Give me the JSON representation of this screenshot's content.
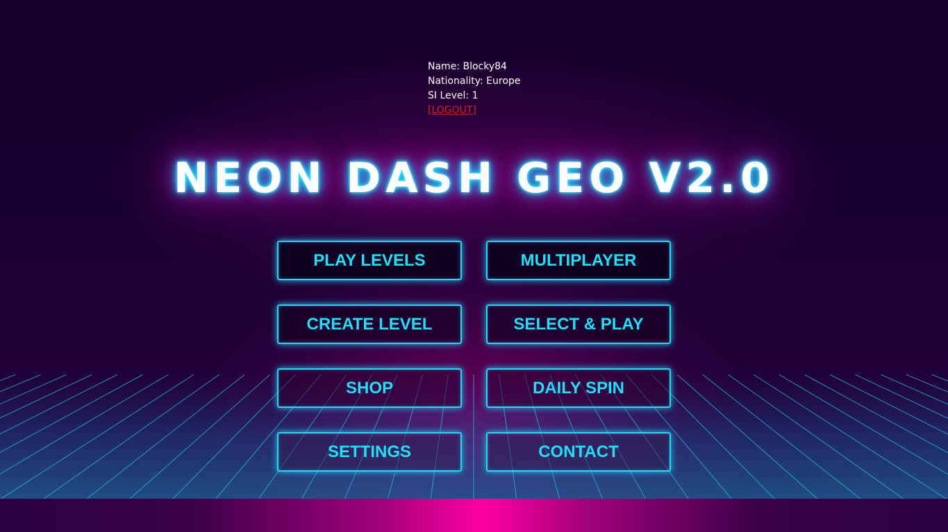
{
  "player": {
    "name_line": "Name: Blocky84",
    "nationality_line": "Nationality: Europe",
    "level_line": "SI Level: 1",
    "logout_label": "[LOGOUT]"
  },
  "title": "NEON DASH GEO V2.0",
  "menu": {
    "play_levels": "PLAY LEVELS",
    "multiplayer": "MULTIPLAYER",
    "create_level": "CREATE LEVEL",
    "select_play": "SELECT & PLAY",
    "shop": "SHOP",
    "daily_spin": "DAILY SPIN",
    "settings": "SETTINGS",
    "contact": "CONTACT"
  },
  "colors": {
    "accent": "#1fe0f8",
    "glow_pink": "#ff00a0",
    "logout": "#e0182a",
    "background": "#14002a"
  }
}
